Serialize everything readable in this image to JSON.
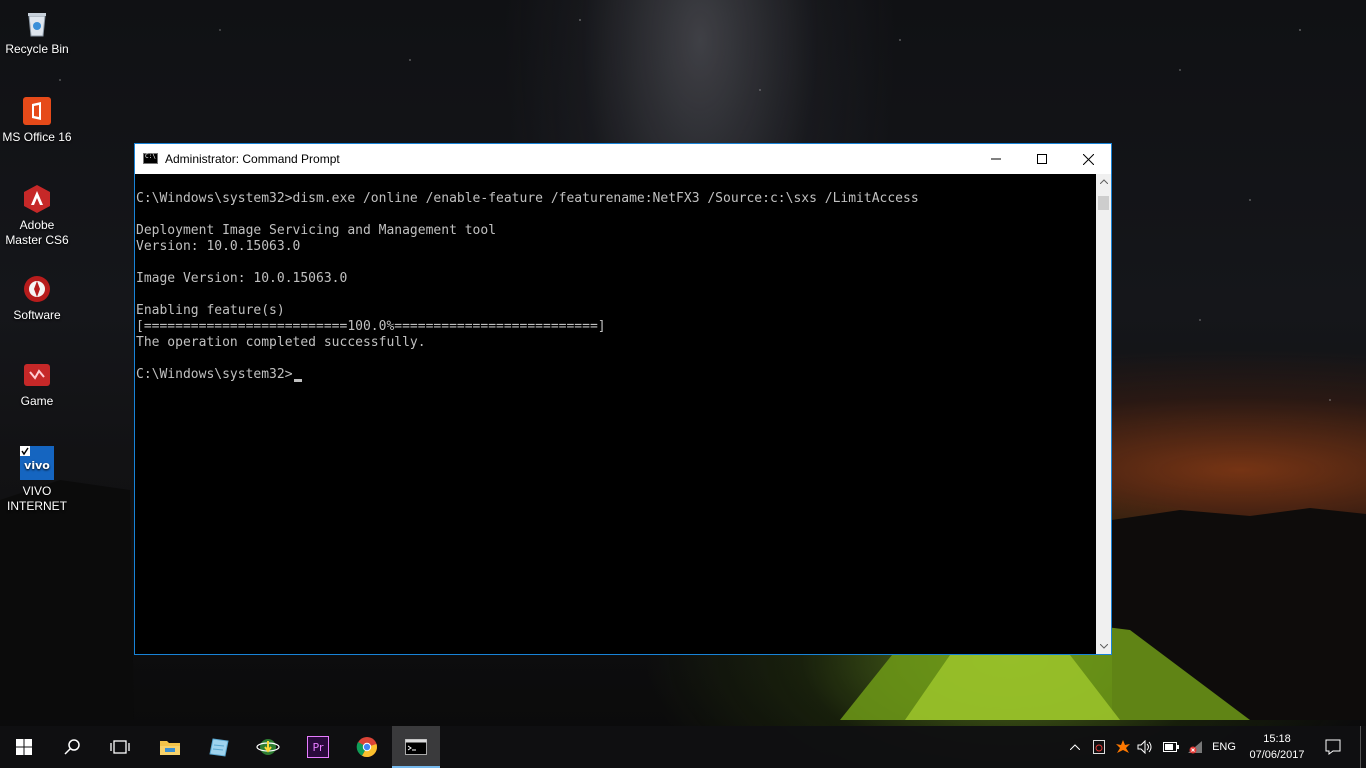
{
  "desktop": {
    "icons": [
      {
        "label": "Recycle Bin"
      },
      {
        "label": "MS Office 16"
      },
      {
        "label": "Adobe Master CS6"
      },
      {
        "label": "Software"
      },
      {
        "label": "Game"
      },
      {
        "label": "VIVO INTERNET"
      }
    ]
  },
  "window": {
    "title": "Administrator: Command Prompt",
    "console_lines": [
      "C:\\Windows\\system32>dism.exe /online /enable-feature /featurename:NetFX3 /Source:c:\\sxs /LimitAccess",
      "Deployment Image Servicing and Management tool",
      "Version: 10.0.15063.0",
      "Image Version: 10.0.15063.0",
      "Enabling feature(s)",
      "[==========================100.0%==========================]",
      "The operation completed successfully.",
      "C:\\Windows\\system32>"
    ]
  },
  "taskbar": {
    "language": "ENG",
    "time": "15:18",
    "date": "07/06/2017"
  },
  "colors": {
    "accent": "#1883d7",
    "console_bg": "#000000",
    "console_fg": "#c0c0c0"
  }
}
